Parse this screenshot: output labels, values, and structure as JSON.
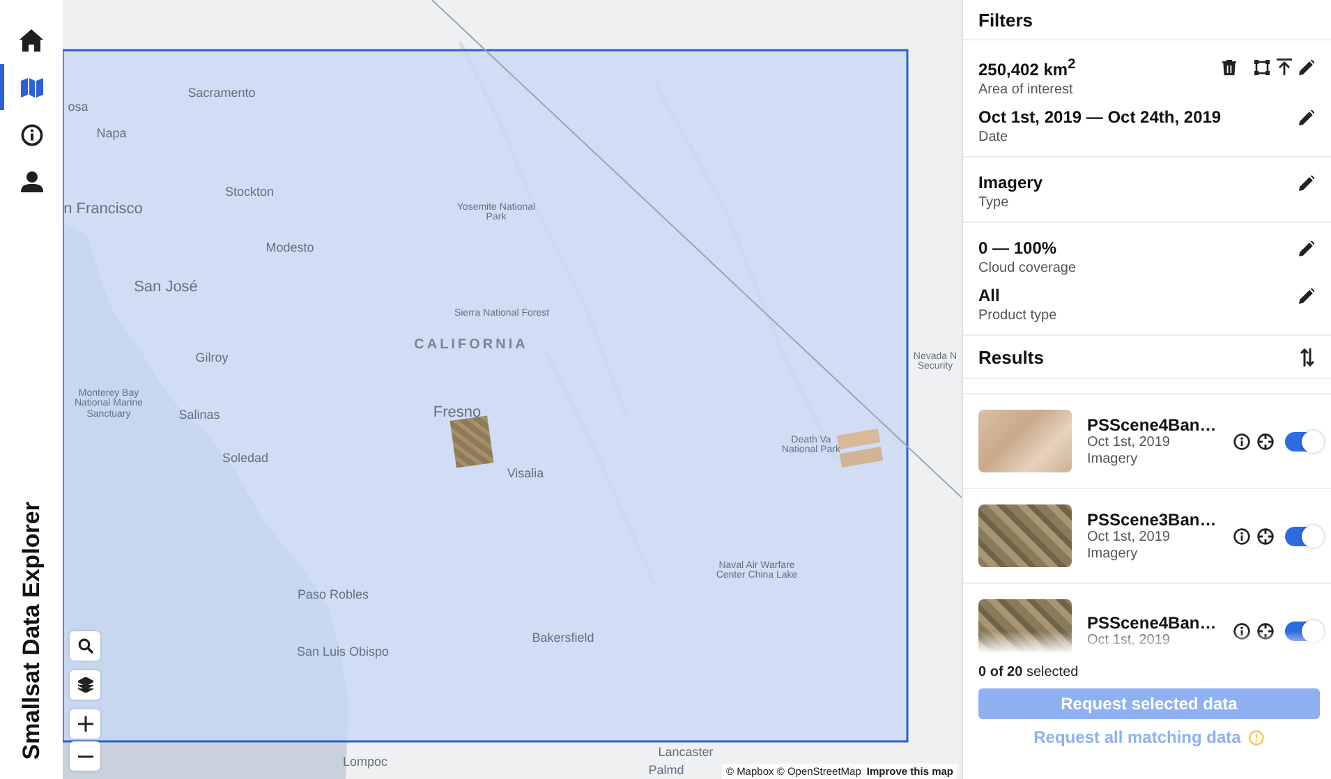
{
  "sidebar": {
    "items": [
      {
        "selected": false
      },
      {
        "selected": true
      },
      {
        "selected": false
      },
      {
        "selected": false
      }
    ],
    "title": "Smallsat Data Explorer"
  },
  "map": {
    "labels": [
      {
        "text": "Sacramento",
        "kind": "city"
      },
      {
        "text": "osa",
        "kind": "city"
      },
      {
        "text": "Napa",
        "kind": "city"
      },
      {
        "text": "Stockton",
        "kind": "city"
      },
      {
        "text": "n Francisco",
        "kind": "major"
      },
      {
        "text": "Yosemite National Park",
        "kind": "park"
      },
      {
        "text": "Modesto",
        "kind": "city"
      },
      {
        "text": "San José",
        "kind": "major"
      },
      {
        "text": "Sierra National Forest",
        "kind": "park"
      },
      {
        "text": "CALIFORNIA",
        "kind": "region"
      },
      {
        "text": "Gilroy",
        "kind": "city"
      },
      {
        "text": "Monterey Bay National Marine Sanctuary",
        "kind": "park"
      },
      {
        "text": "Salinas",
        "kind": "city"
      },
      {
        "text": "Fresno",
        "kind": "major"
      },
      {
        "text": "Soledad",
        "kind": "city"
      },
      {
        "text": "Visalia",
        "kind": "city"
      },
      {
        "text": "Death Va National Park",
        "kind": "park"
      },
      {
        "text": "Nevada N Security",
        "kind": "park"
      },
      {
        "text": "Paso Robles",
        "kind": "city"
      },
      {
        "text": "Naval Air Warfare Center China Lake",
        "kind": "park"
      },
      {
        "text": "Bakersfield",
        "kind": "city"
      },
      {
        "text": "San Luis Obispo",
        "kind": "city"
      },
      {
        "text": "Lancaster",
        "kind": "city"
      },
      {
        "text": "Lompoc",
        "kind": "city"
      },
      {
        "text": "Palmd",
        "kind": "city"
      }
    ],
    "attribution": "© Mapbox © OpenStreetMap",
    "improve_link": "Improve this map"
  },
  "filters": {
    "title": "Filters",
    "groups": [
      [
        {
          "value": "250,402 km$^{2}$",
          "label": "Area of interest",
          "actions": [
            {
              "kind": "delete"
            },
            {
              "kind": "draw"
            },
            {
              "kind": "upload"
            },
            {
              "kind": "edit"
            }
          ]
        },
        {
          "value": "Oct 1st, 2019 — Oct 24th, 2019",
          "label": "Date",
          "actions": [
            {
              "kind": "edit"
            }
          ]
        }
      ],
      [
        {
          "value": "Imagery",
          "label": "Type",
          "actions": [
            {
              "kind": "edit"
            }
          ]
        }
      ],
      [
        {
          "value": "0 — 100%",
          "label": "Cloud coverage",
          "actions": [
            {
              "kind": "edit"
            }
          ]
        },
        {
          "value": "All",
          "label": "Product type",
          "actions": [
            {
              "kind": "edit"
            }
          ]
        }
      ]
    ]
  },
  "results": {
    "title": "Results",
    "items": [
      {
        "title": "PSScene4Ban…",
        "date": "Oct 1st, 2019",
        "type": "Imagery",
        "on": true
      },
      {
        "title": "PSScene3Ban…",
        "date": "Oct 1st, 2019",
        "type": "Imagery",
        "on": true
      },
      {
        "title": "PSScene4Ban…",
        "date": "Oct 1st, 2019",
        "on": true
      }
    ],
    "count_bold": "0 of 20",
    "count_rest": "selected",
    "primary_button": {
      "label": "Request selected data",
      "disabled": true
    },
    "secondary_button": "Request all matching data"
  }
}
